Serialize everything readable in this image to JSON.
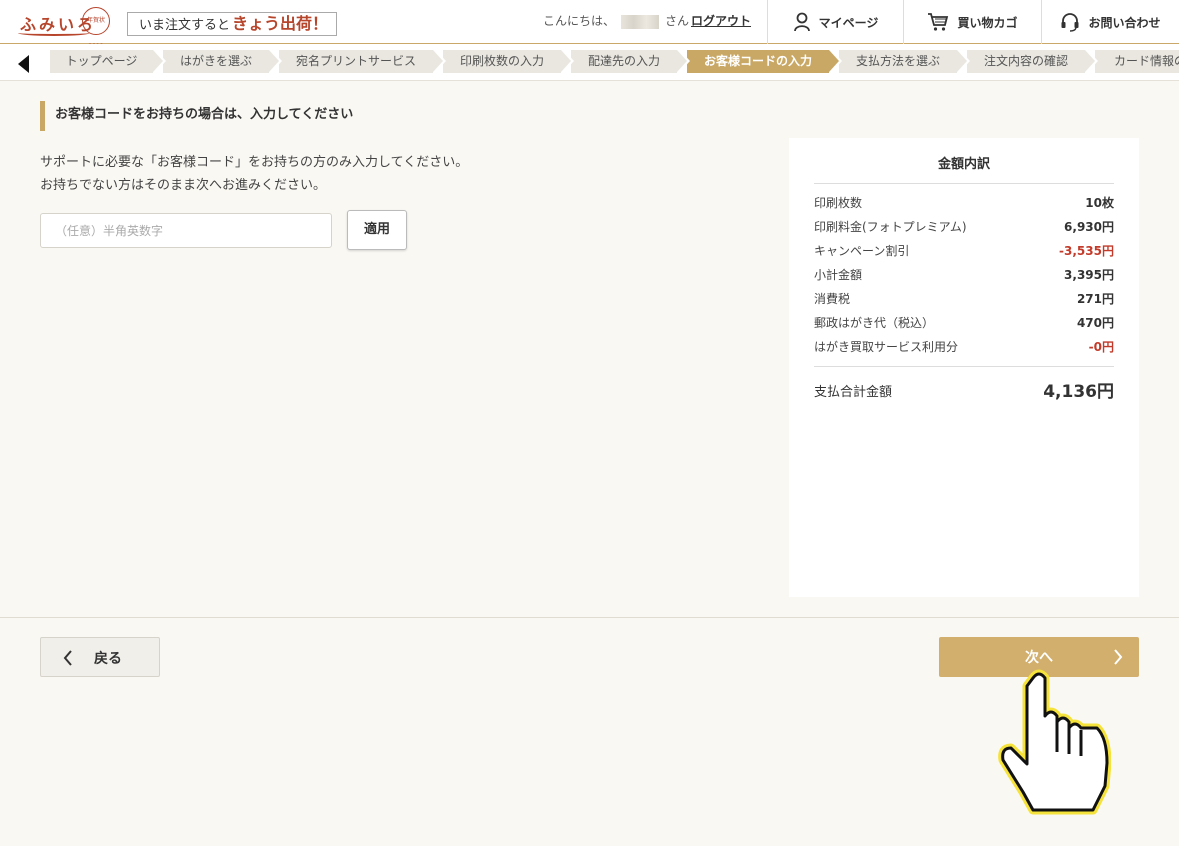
{
  "header": {
    "logo_text": "ふみいろ",
    "logo_seal_text": "年賀状2019",
    "promo_prefix": "いま注文すると",
    "promo_highlight": "きょう出荷！",
    "greeting_prefix": "こんにちは、",
    "greeting_suffix": "さん",
    "logout_label": "ログアウト",
    "nav": [
      {
        "label": "マイページ",
        "icon": "person-icon"
      },
      {
        "label": "買い物カゴ",
        "icon": "cart-icon"
      },
      {
        "label": "お問い合わせ",
        "icon": "headset-icon"
      }
    ]
  },
  "steps": [
    {
      "label": "トップページ",
      "active": false
    },
    {
      "label": "はがきを選ぶ",
      "active": false
    },
    {
      "label": "宛名プリントサービス",
      "active": false
    },
    {
      "label": "印刷枚数の入力",
      "active": false
    },
    {
      "label": "配達先の入力",
      "active": false
    },
    {
      "label": "お客様コードの入力",
      "active": true
    },
    {
      "label": "支払方法を選ぶ",
      "active": false
    },
    {
      "label": "注文内容の確認",
      "active": false
    },
    {
      "label": "カード情報の",
      "active": false
    }
  ],
  "main": {
    "section_title": "お客様コードをお持ちの場合は、入力してください",
    "desc_line1": "サポートに必要な「お客様コード」をお持ちの方のみ入力してください。",
    "desc_line2": "お持ちでない方はそのまま次へお進みください。",
    "code_placeholder": "（任意）半角英数字",
    "apply_label": "適用"
  },
  "summary": {
    "title": "金額内訳",
    "rows": [
      {
        "label": "印刷枚数",
        "value": "10枚",
        "negative": false
      },
      {
        "label": "印刷料金(フォトプレミアム)",
        "value": "6,930円",
        "negative": false
      },
      {
        "label": "キャンペーン割引",
        "value": "-3,535円",
        "negative": true
      },
      {
        "label": "小計金額",
        "value": "3,395円",
        "negative": false
      },
      {
        "label": "消費税",
        "value": "271円",
        "negative": false
      },
      {
        "label": "郵政はがき代（税込）",
        "value": "470円",
        "negative": false
      },
      {
        "label": "はがき買取サービス利用分",
        "value": "-0円",
        "negative": true
      }
    ],
    "total_label": "支払合計金額",
    "total_value": "4,136円"
  },
  "footer": {
    "back_label": "戻る",
    "next_label": "次へ"
  },
  "colors": {
    "accent_gold": "#c9a866",
    "next_button": "#d2af6c",
    "brand_red": "#b6452c",
    "negative_red": "#c23b2a",
    "background": "#faf8f3"
  }
}
